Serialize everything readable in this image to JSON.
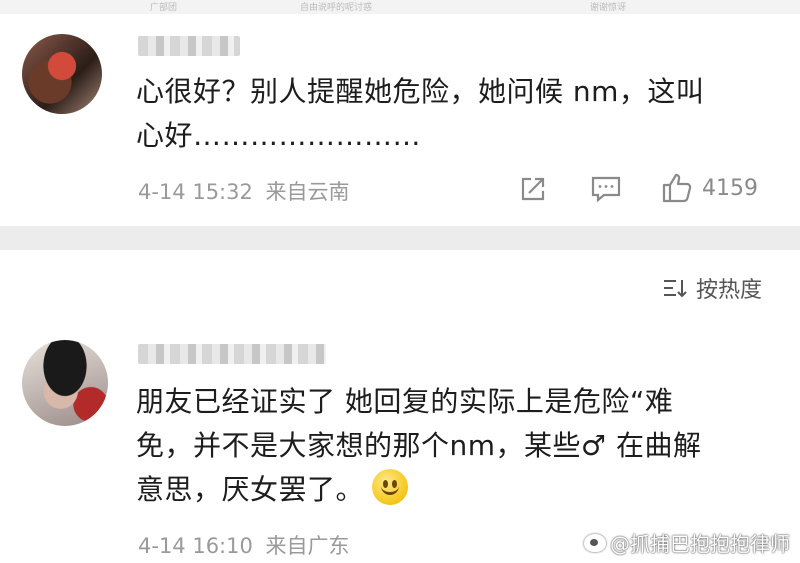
{
  "top_bar": {
    "left_text": "广部团",
    "center_text": "自由说呼的呢讨惑",
    "right_text": "谢谢惊讶"
  },
  "comments": [
    {
      "username": "",
      "text_line1": "心很好？别人提醒她危险，她问候 nm，这叫",
      "text_line2": "心好……………………",
      "timestamp": "4-14 15:32",
      "location": "来自云南",
      "like_count": "4159"
    },
    {
      "username": "",
      "text_line1": "朋友已经证实了 她回复的实际上是危险“难",
      "text_line2": "免，并不是大家想的那个nm，某些♂ 在曲解",
      "text_line3": "意思，厌女罢了。",
      "timestamp": "4-14 16:10",
      "location": "来自广东"
    }
  ],
  "sort": {
    "label": "按热度"
  },
  "watermark": {
    "text": "@抓捕巴抱抱抱律师"
  },
  "icons": {
    "share": "share-icon",
    "comment": "comment-icon",
    "like": "thumbs-up-icon",
    "sort": "sort-icon",
    "emoji": "smile-emoji-icon"
  },
  "colors": {
    "meta_gray": "#9a9a9a",
    "background": "#ececec",
    "card": "#ffffff"
  }
}
